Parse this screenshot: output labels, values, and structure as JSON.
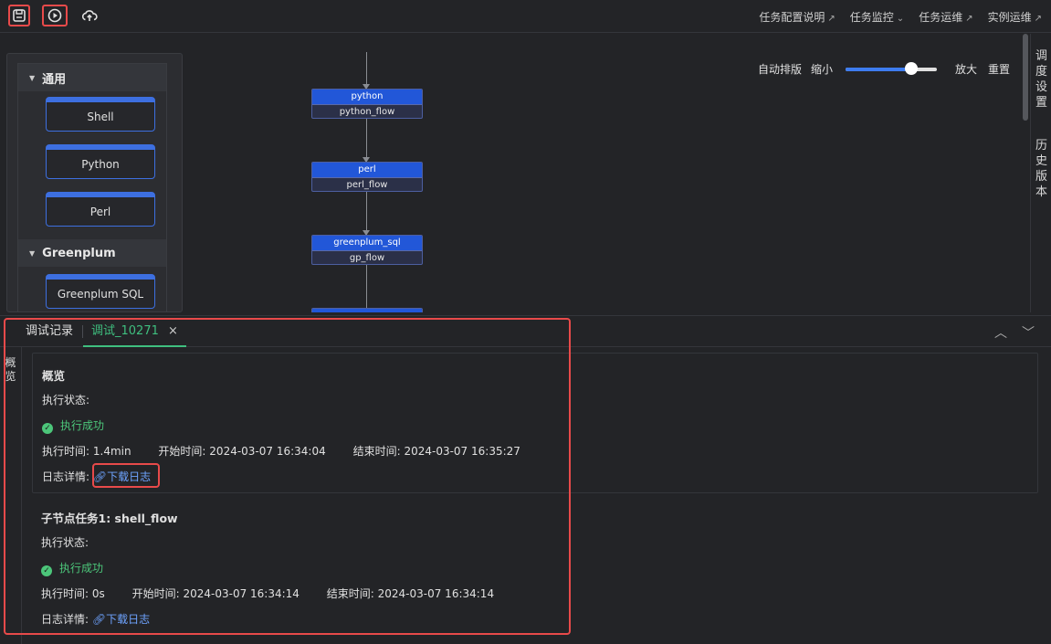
{
  "toolbar": {
    "links": [
      {
        "label": "任务配置说明",
        "suffix": "↗"
      },
      {
        "label": "任务监控",
        "suffix": "⌄"
      },
      {
        "label": "任务运维",
        "suffix": "↗"
      },
      {
        "label": "实例运维",
        "suffix": "↗"
      }
    ]
  },
  "palette": {
    "groups": [
      {
        "label": "通用",
        "items": [
          "Shell",
          "Python",
          "Perl"
        ]
      },
      {
        "label": "Greenplum",
        "items": [
          "Greenplum SQL"
        ]
      }
    ]
  },
  "canvas": {
    "zoom": {
      "auto_layout": "自动排版",
      "zoom_out": "缩小",
      "zoom_in": "放大",
      "reset": "重置",
      "level": 0.72
    },
    "nodes": [
      {
        "type": "python",
        "name": "python_flow"
      },
      {
        "type": "perl",
        "name": "perl_flow"
      },
      {
        "type": "greenplum_sql",
        "name": "gp_flow"
      }
    ]
  },
  "right_rail": {
    "tabs": [
      [
        "调",
        "度",
        "设",
        "置"
      ],
      [
        "历",
        "史",
        "版",
        "本"
      ]
    ]
  },
  "bottom": {
    "tabs": [
      {
        "label": "调试记录"
      },
      {
        "label": "调试_10271",
        "close": "×"
      }
    ],
    "side_label": [
      "概",
      "览"
    ],
    "overview": {
      "title": "概览",
      "status_label": "执行状态:",
      "status": "执行成功",
      "duration_label": "执行时间:",
      "duration": "1.4min",
      "start_label": "开始时间:",
      "start": "2024-03-07 16:34:04",
      "end_label": "结束时间:",
      "end": "2024-03-07 16:35:27",
      "log_label": "日志详情:",
      "log_link": "下载日志"
    },
    "subtask": {
      "title": "子节点任务1: shell_flow",
      "status_label": "执行状态:",
      "status": "执行成功",
      "duration_label": "执行时间:",
      "duration": "0s",
      "start_label": "开始时间:",
      "start": "2024-03-07 16:34:14",
      "end_label": "结束时间:",
      "end": "2024-03-07 16:34:14",
      "log_label": "日志详情:",
      "log_link": "下载日志"
    }
  },
  "colors": {
    "accent": "#2257d8",
    "success": "#4cc67a",
    "link": "#6ea3ff",
    "highlight": "#e84a4a",
    "tab_active": "#3fbf7f"
  }
}
